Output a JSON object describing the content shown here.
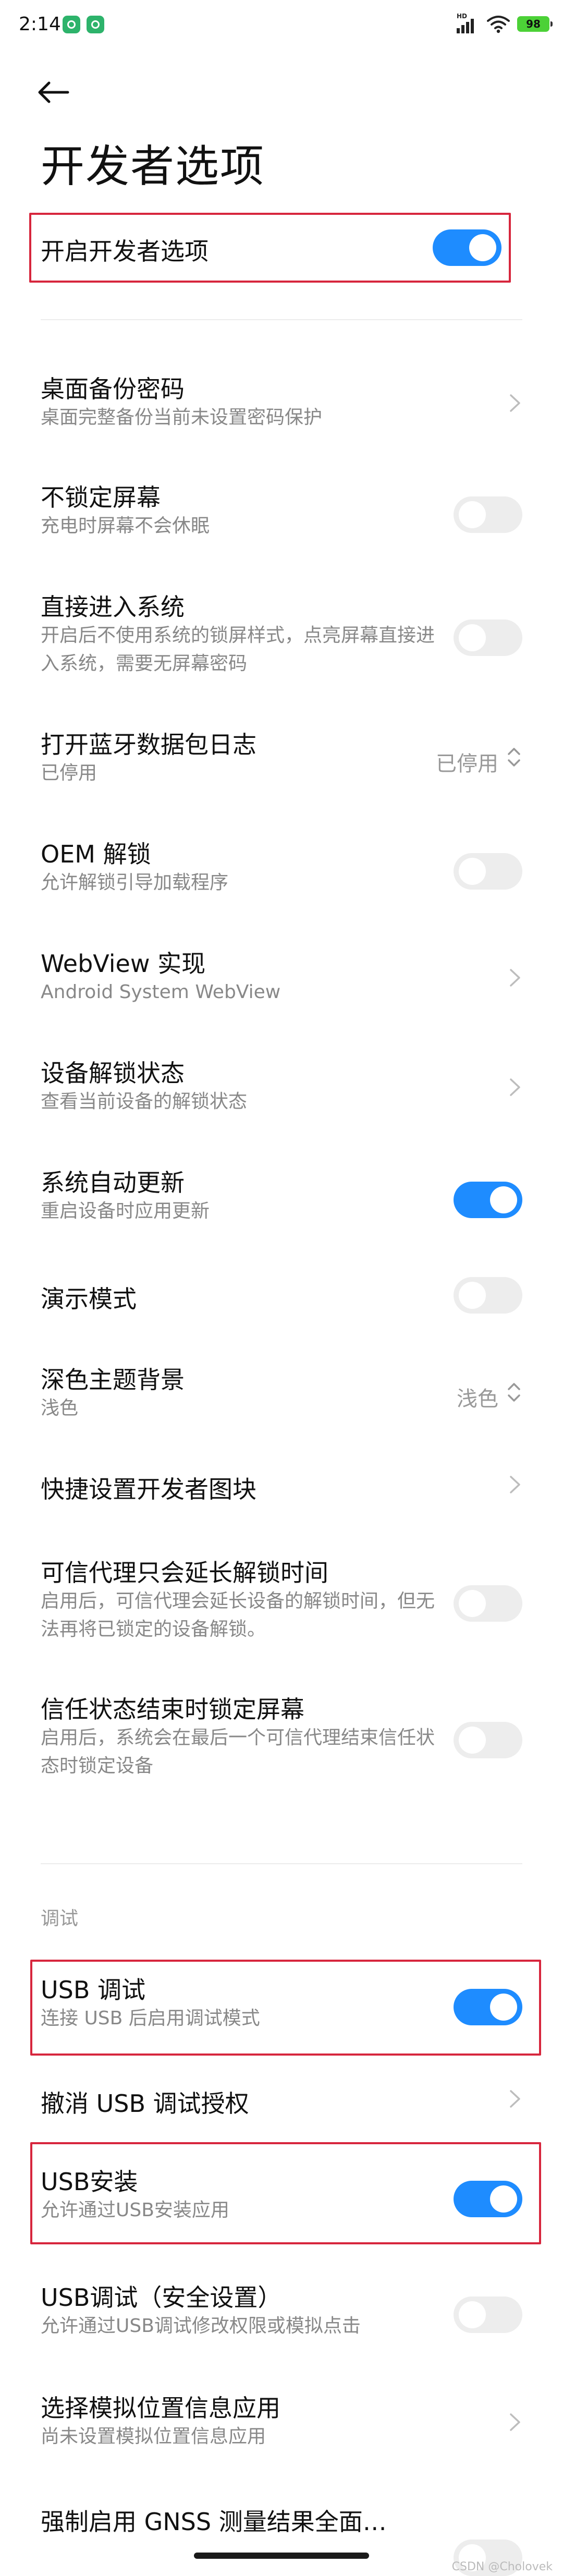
{
  "status_bar": {
    "time": "2:14",
    "signal_badge": "HD",
    "battery": "98"
  },
  "header": {
    "title": "开发者选项"
  },
  "master_toggle": {
    "label": "开启开发者选项",
    "on": true
  },
  "settings": [
    {
      "title": "桌面备份密码",
      "subtitle": "桌面完整备份当前未设置密码保护",
      "control": "chevron"
    },
    {
      "title": "不锁定屏幕",
      "subtitle": "充电时屏幕不会休眠",
      "control": "toggle",
      "on": false
    },
    {
      "title": "直接进入系统",
      "subtitle": "开启后不使用系统的锁屏样式，点亮屏幕直接进入系统，需要无屏幕密码",
      "control": "toggle",
      "on": false
    },
    {
      "title": "打开蓝牙数据包日志",
      "subtitle": "已停用",
      "control": "select",
      "value": "已停用"
    },
    {
      "title": "OEM 解锁",
      "subtitle": "允许解锁引导加载程序",
      "control": "toggle",
      "on": false
    },
    {
      "title": "WebView 实现",
      "subtitle": "Android System WebView",
      "control": "chevron"
    },
    {
      "title": "设备解锁状态",
      "subtitle": "查看当前设备的解锁状态",
      "control": "chevron"
    },
    {
      "title": "系统自动更新",
      "subtitle": "重启设备时应用更新",
      "control": "toggle",
      "on": true
    },
    {
      "title": "演示模式",
      "subtitle": "",
      "control": "toggle",
      "on": false
    },
    {
      "title": "深色主题背景",
      "subtitle": "浅色",
      "control": "select",
      "value": "浅色"
    },
    {
      "title": "快捷设置开发者图块",
      "subtitle": "",
      "control": "chevron"
    },
    {
      "title": "可信代理只会延长解锁时间",
      "subtitle": "启用后，可信代理会延长设备的解锁时间，但无法再将已锁定的设备解锁。",
      "control": "toggle",
      "on": false
    },
    {
      "title": "信任状态结束时锁定屏幕",
      "subtitle": "启用后，系统会在最后一个可信代理结束信任状态时锁定设备",
      "control": "toggle",
      "on": false
    }
  ],
  "debug_section": {
    "header": "调试",
    "items": [
      {
        "title": "USB 调试",
        "subtitle": "连接 USB 后启用调试模式",
        "control": "toggle",
        "on": true
      },
      {
        "title": "撤消 USB 调试授权",
        "subtitle": "",
        "control": "chevron"
      },
      {
        "title": "USB安装",
        "subtitle": "允许通过USB安装应用",
        "control": "toggle",
        "on": true
      },
      {
        "title": "USB调试（安全设置）",
        "subtitle": "允许通过USB调试修改权限或模拟点击",
        "control": "toggle",
        "on": false
      },
      {
        "title": "选择模拟位置信息应用",
        "subtitle": "尚未设置模拟位置信息应用",
        "control": "chevron"
      },
      {
        "title": "强制启用 GNSS 测量结果全面…",
        "subtitle": "",
        "control": "toggle",
        "on": false
      }
    ]
  },
  "watermark": "CSDN @Cholovek",
  "colors": {
    "accent": "#1e8cff",
    "toggle_off": "#ededed",
    "highlight_border": "#d7263d",
    "subtitle": "#888888"
  }
}
